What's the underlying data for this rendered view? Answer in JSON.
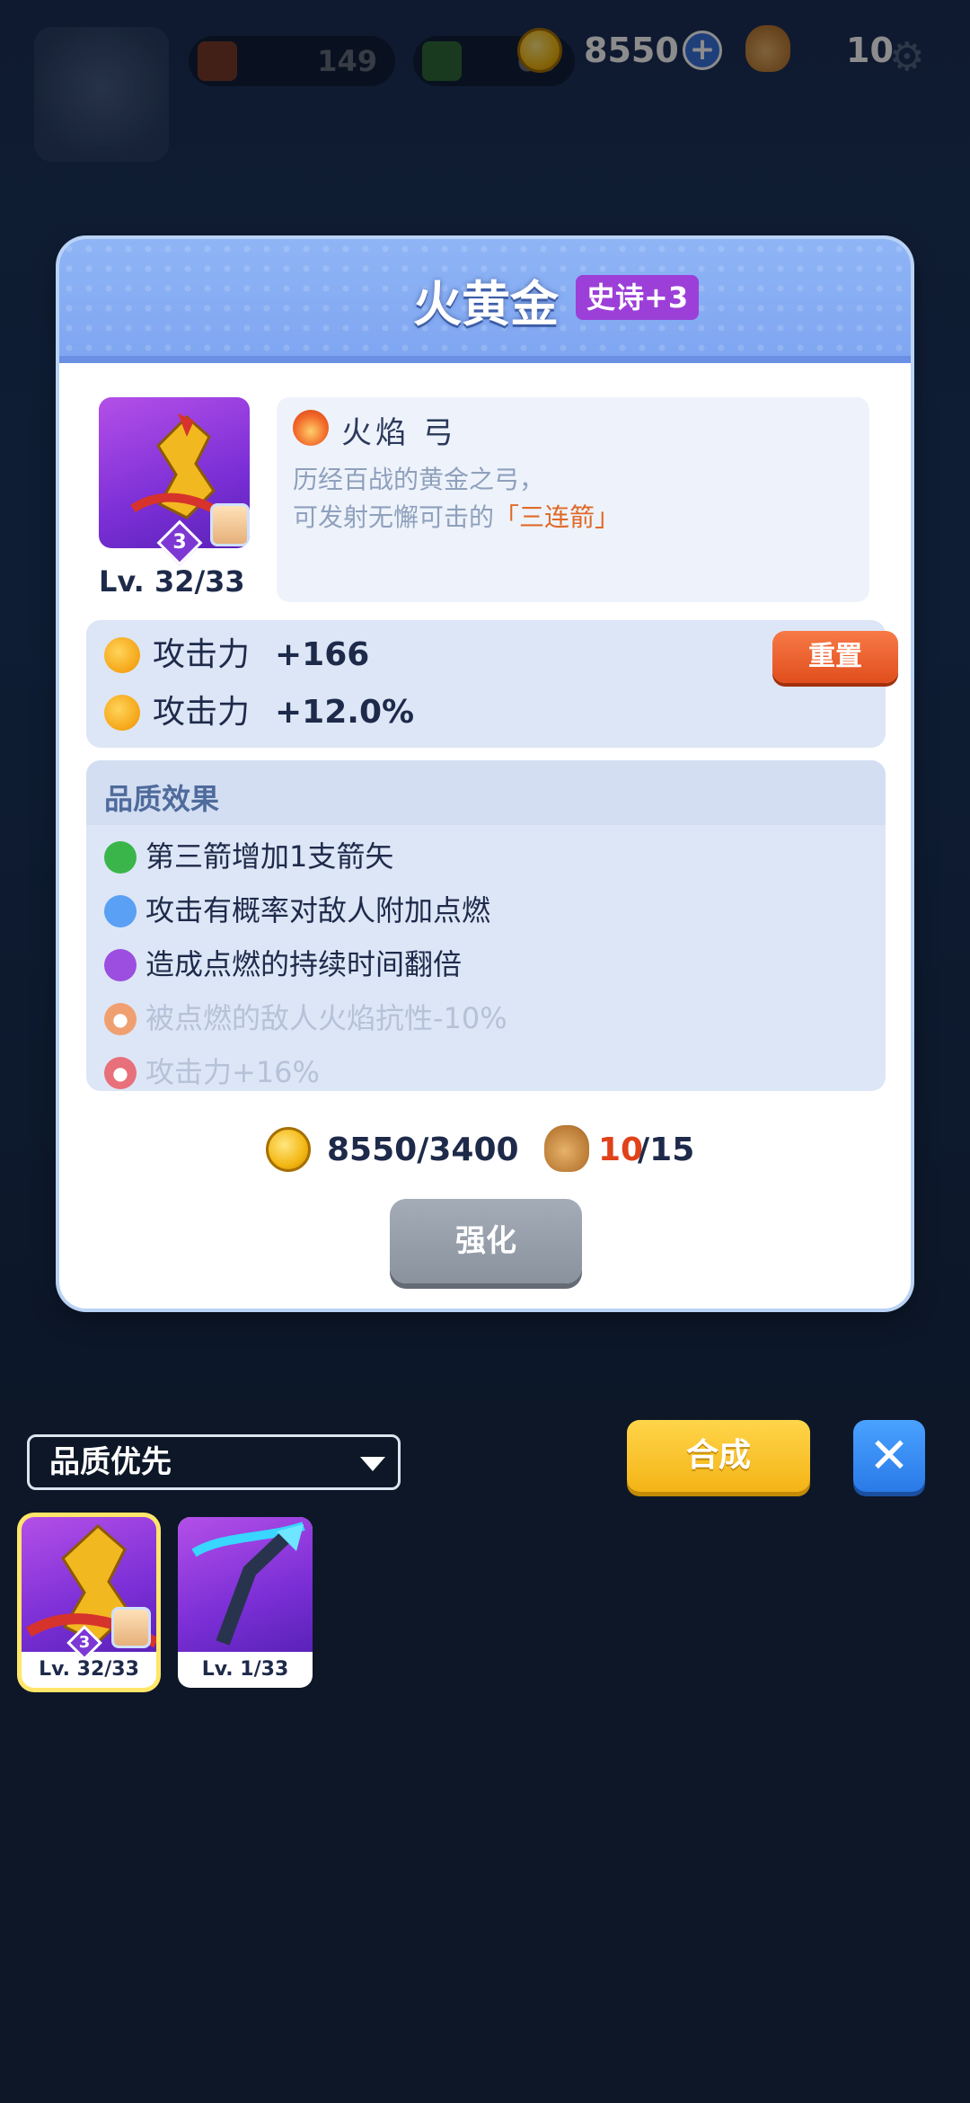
{
  "hud": {
    "resources_bg": [
      {
        "name": "book",
        "value": "149"
      },
      {
        "name": "gem",
        "value": "60"
      }
    ],
    "coins": "8550",
    "bags": "10"
  },
  "modal": {
    "title": "火黄金",
    "rarity": "史诗+3",
    "star_level": "3",
    "level": "Lv. 32/33",
    "weapon_type": "火焰 弓",
    "description_line1": "历经百战的黄金之弓，",
    "description_line2_pre": "可发射无懈可击的",
    "description_line2_hl": "「三连箭」",
    "stats": [
      {
        "label": "攻击力",
        "value": "+166"
      },
      {
        "label": "攻击力",
        "value": "+12.0%"
      }
    ],
    "reset_label": "重置",
    "quality_title": "品质效果",
    "quality_effects": [
      {
        "text": "第三箭增加1支箭矢",
        "color": "#3ab54a",
        "locked": false
      },
      {
        "text": "攻击有概率对敌人附加点燃",
        "color": "#5aa0f5",
        "locked": false
      },
      {
        "text": "造成点燃的持续时间翻倍",
        "color": "#9c4ee0",
        "locked": false
      },
      {
        "text": "被点燃的敌人火焰抗性-10%",
        "color": "#f0a070",
        "locked": true
      },
      {
        "text": "攻击力+16%",
        "color": "#e8707a",
        "locked": true
      }
    ],
    "cost_coins": "8550/3400",
    "cost_bags_have": "10",
    "cost_bags_need": "/15",
    "upgrade_label": "强化"
  },
  "bottom": {
    "sort_label": "品质优先",
    "merge_label": "合成",
    "close_icon": "close-icon",
    "inventory": [
      {
        "level": "Lv. 32/33",
        "star": "3",
        "selected": true
      },
      {
        "level": "Lv. 1/33",
        "selected": false
      }
    ]
  }
}
